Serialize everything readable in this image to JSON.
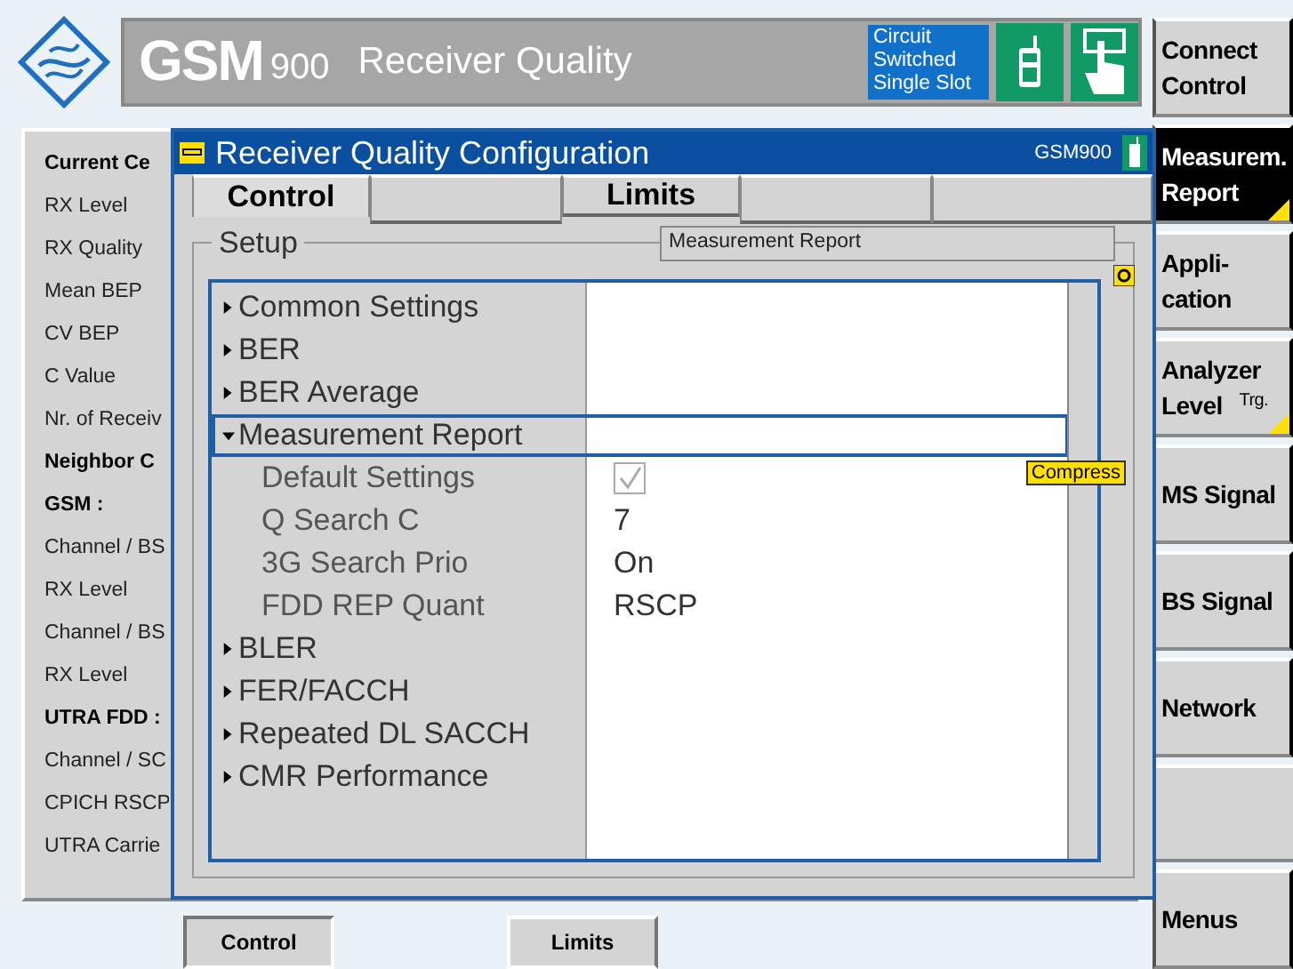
{
  "header": {
    "brand": "GSM",
    "band": "900",
    "title": "Receiver Quality",
    "mode_lines": [
      "Circuit",
      "Switched",
      "Single Slot"
    ]
  },
  "softkeys": [
    {
      "lines": [
        "Connect",
        "Control"
      ],
      "selected": false
    },
    {
      "lines": [
        "Measurem.",
        "Report"
      ],
      "selected": true
    },
    {
      "lines": [
        "Appli-",
        "cation"
      ],
      "selected": false
    },
    {
      "lines": [
        "Analyzer",
        "Level"
      ],
      "hint": "Trg.",
      "selected": false
    },
    {
      "lines": [
        "MS Signal"
      ],
      "selected": false
    },
    {
      "lines": [
        "BS Signal"
      ],
      "selected": false
    },
    {
      "lines": [
        "Network"
      ],
      "selected": false
    }
  ],
  "menus_key": "Menus",
  "panel": {
    "labels": [
      {
        "text": "Current Ce",
        "kind": "heading"
      },
      {
        "text": "RX Level",
        "kind": "label"
      },
      {
        "text": "RX Quality",
        "kind": "label"
      },
      {
        "text": "Mean BEP",
        "kind": "label"
      },
      {
        "text": "CV BEP",
        "kind": "label"
      },
      {
        "text": "C Value",
        "kind": "label"
      },
      {
        "text": "Nr. of Receiv",
        "kind": "label"
      },
      {
        "text": "Neighbor C",
        "kind": "heading"
      },
      {
        "text": "GSM :",
        "kind": "heading"
      },
      {
        "text": "Channel / BS",
        "kind": "label"
      },
      {
        "text": "RX Level",
        "kind": "label"
      },
      {
        "text": "Channel / BS",
        "kind": "label"
      },
      {
        "text": "RX Level",
        "kind": "label"
      },
      {
        "text": "UTRA FDD :",
        "kind": "heading"
      },
      {
        "text": "Channel / SC",
        "kind": "label"
      },
      {
        "text": "CPICH RSCP",
        "kind": "label"
      },
      {
        "text": "UTRA Carrie",
        "kind": "label"
      }
    ]
  },
  "bottom_buttons": [
    {
      "label": "Control",
      "selected": true
    },
    {
      "label": "Limits",
      "selected": false
    }
  ],
  "dialog": {
    "title": "Receiver Quality Configuration",
    "band": "GSM900",
    "tabs": [
      {
        "label": "Control",
        "selected": true
      },
      {
        "label": "Limits",
        "selected": false
      }
    ],
    "group": "Setup",
    "path_field": "Measurement Report",
    "tag": "Compress",
    "tree": [
      {
        "label": "Common Settings",
        "expanded": false,
        "selected": false
      },
      {
        "label": "BER",
        "expanded": false,
        "selected": false
      },
      {
        "label": "BER Average",
        "expanded": false,
        "selected": false
      },
      {
        "label": "Measurement Report",
        "expanded": true,
        "selected": true,
        "children": [
          {
            "label": "Default Settings",
            "kind": "checkbox",
            "checked": true,
            "disabled": true
          },
          {
            "label": "Q Search C",
            "kind": "value",
            "value": "7"
          },
          {
            "label": "3G Search Prio",
            "kind": "value",
            "value": "On"
          },
          {
            "label": "FDD REP Quant",
            "kind": "value",
            "value": "RSCP"
          }
        ]
      },
      {
        "label": "BLER",
        "expanded": false,
        "selected": false
      },
      {
        "label": "FER/FACCH",
        "expanded": false,
        "selected": false
      },
      {
        "label": "Repeated DL SACCH",
        "expanded": false,
        "selected": false
      },
      {
        "label": "CMR Performance",
        "expanded": false,
        "selected": false
      }
    ]
  }
}
